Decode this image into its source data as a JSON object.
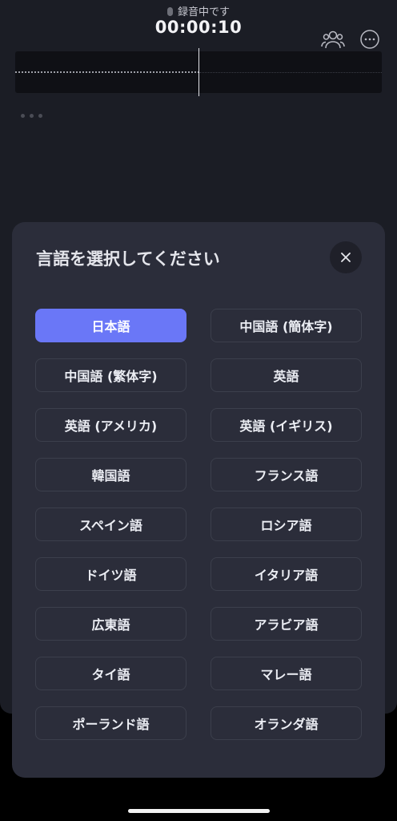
{
  "header": {
    "status": "録音中です",
    "timer": "00:00:10"
  },
  "modal": {
    "title": "言語を選択してください",
    "close_label": "×",
    "languages": [
      {
        "label": "日本語",
        "selected": true
      },
      {
        "label": "中国語 (簡体字)"
      },
      {
        "label": "中国語 (繁体字)"
      },
      {
        "label": "英語"
      },
      {
        "label": "英語 (アメリカ)"
      },
      {
        "label": "英語 (イギリス)"
      },
      {
        "label": "韓国語"
      },
      {
        "label": "フランス語"
      },
      {
        "label": "スペイン語"
      },
      {
        "label": "ロシア語"
      },
      {
        "label": "ドイツ語"
      },
      {
        "label": "イタリア語"
      },
      {
        "label": "広東語"
      },
      {
        "label": "アラビア語"
      },
      {
        "label": "タイ語"
      },
      {
        "label": "マレー語"
      },
      {
        "label": "ポーランド語"
      },
      {
        "label": "オランダ語"
      }
    ]
  },
  "colors": {
    "accent": "#6a77f7",
    "sheet": "#2b2d3a",
    "background": "#1b1d25"
  }
}
